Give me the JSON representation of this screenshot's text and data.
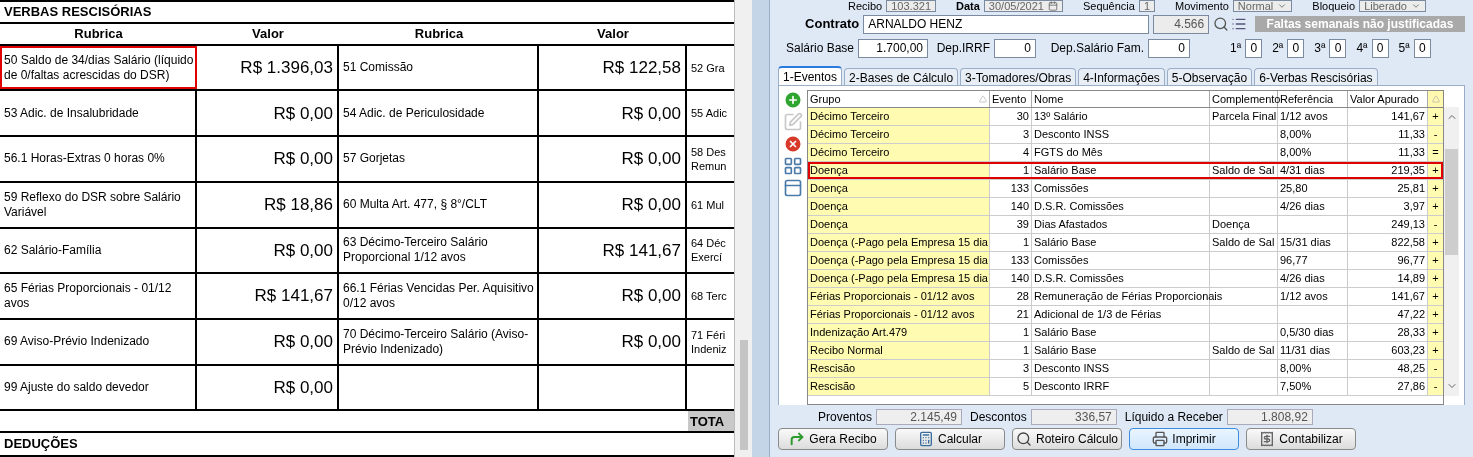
{
  "document": {
    "title": "VERBAS RESCISÓRIAS",
    "columns": [
      "Rubrica",
      "Valor",
      "Rubrica",
      "Valor"
    ],
    "rows": [
      {
        "cells": [
          {
            "text": "50 Saldo de 34/dias Salário (líquido de 0/faltas acrescidas do DSR)",
            "highlighted": true
          },
          {
            "text": "R$ 1.396,03"
          },
          {
            "text": "51 Comissão"
          },
          {
            "text": "R$ 122,58"
          },
          {
            "lines": [
              "52 Gra"
            ]
          }
        ]
      },
      {
        "cells": [
          {
            "text": "53 Adic. de Insalubridade"
          },
          {
            "text": "R$ 0,00"
          },
          {
            "text": "54 Adic. de Periculosidade"
          },
          {
            "text": "R$ 0,00"
          },
          {
            "lines": [
              "55 Adic"
            ]
          }
        ]
      },
      {
        "cells": [
          {
            "text": "56.1 Horas-Extras 0 horas 0%"
          },
          {
            "text": "R$ 0,00"
          },
          {
            "text": "57 Gorjetas"
          },
          {
            "text": "R$ 0,00"
          },
          {
            "lines": [
              "58 Des",
              "Remun"
            ]
          }
        ]
      },
      {
        "cells": [
          {
            "text": "59 Reflexo do DSR sobre Salário Variável"
          },
          {
            "text": "R$ 18,86"
          },
          {
            "text": "60 Multa Art. 477, § 8°/CLT"
          },
          {
            "text": "R$ 0,00"
          },
          {
            "lines": [
              "61 Mul"
            ]
          }
        ]
      },
      {
        "cells": [
          {
            "text": "62 Salário-Família"
          },
          {
            "text": "R$ 0,00"
          },
          {
            "text": "63 Décimo-Terceiro Salário Proporcional 1/12 avos"
          },
          {
            "text": "R$ 141,67"
          },
          {
            "lines": [
              "64 Déc",
              "Exercí"
            ]
          }
        ]
      },
      {
        "cells": [
          {
            "text": "65 Férias Proporcionais - 01/12 avos"
          },
          {
            "text": "R$ 141,67"
          },
          {
            "text": "66.1 Férias Vencidas Per. Aquisitivo 0/12 avos"
          },
          {
            "text": "R$ 0,00"
          },
          {
            "lines": [
              "68 Terc"
            ]
          }
        ]
      },
      {
        "cells": [
          {
            "text": "69 Aviso-Prévio Indenizado"
          },
          {
            "text": "R$ 0,00"
          },
          {
            "text": "70 Décimo-Terceiro Salário (Aviso-Prévio Indenizado)"
          },
          {
            "text": "R$ 0,00"
          },
          {
            "lines": [
              "71 Féri",
              "Indeniz"
            ]
          }
        ]
      },
      {
        "cells": [
          {
            "text": "99 Ajuste do saldo devedor"
          },
          {
            "text": "R$ 0,00"
          },
          {
            "text": ""
          },
          {
            "text": ""
          },
          {}
        ]
      }
    ],
    "total_label": "TOTA",
    "next_section": "DEDUÇÕES"
  },
  "app": {
    "top_fields": [
      {
        "label": "Recibo",
        "value": "103.321",
        "kind": "text"
      },
      {
        "label": "Data",
        "value": "30/05/2021",
        "kind": "date"
      },
      {
        "label": "Sequência",
        "value": "1",
        "kind": "text"
      },
      {
        "label": "Movimento",
        "value": "Normal",
        "kind": "select"
      },
      {
        "label": "Bloqueio",
        "value": "Liberado",
        "kind": "select"
      }
    ],
    "contrato": {
      "label": "Contrato",
      "name": "ARNALDO HENZ",
      "code": "4.566"
    },
    "faltas_title": "Faltas semanais não justificadas",
    "base_fields": [
      {
        "label": "Salário Base",
        "value": "1.700,00"
      },
      {
        "label": "Dep.IRRF",
        "value": "0"
      },
      {
        "label": "Dep.Salário Fam.",
        "value": "0"
      }
    ],
    "faltas": [
      {
        "label": "1ª",
        "value": "0"
      },
      {
        "label": "2ª",
        "value": "0"
      },
      {
        "label": "3ª",
        "value": "0"
      },
      {
        "label": "4ª",
        "value": "0"
      },
      {
        "label": "5ª",
        "value": "0"
      }
    ],
    "tabs": [
      {
        "label": "1-Eventos",
        "selected": true
      },
      {
        "label": "2-Bases de Cálculo",
        "selected": false
      },
      {
        "label": "3-Tomadores/Obras",
        "selected": false
      },
      {
        "label": "4-Informações",
        "selected": false
      },
      {
        "label": "5-Observação",
        "selected": false
      },
      {
        "label": "6-Verbas Rescisórias",
        "selected": false
      }
    ],
    "grid": {
      "columns": [
        "Grupo",
        "Evento",
        "Nome",
        "Complemento",
        "Referência",
        "Valor Apurado"
      ],
      "rows": [
        {
          "grupo": "Décimo Terceiro",
          "evento": "30",
          "nome": "13º Salário",
          "complemento": "Parcela Final",
          "referencia": "1/12 avos",
          "valor": "141,67",
          "sinal": "+",
          "highlighted": false
        },
        {
          "grupo": "Décimo Terceiro",
          "evento": "3",
          "nome": "Desconto INSS",
          "complemento": "",
          "referencia": "8,00%",
          "valor": "11,33",
          "sinal": "-",
          "highlighted": false
        },
        {
          "grupo": "Décimo Terceiro",
          "evento": "4",
          "nome": "FGTS do Mês",
          "complemento": "",
          "referencia": "8,00%",
          "valor": "11,33",
          "sinal": "=",
          "highlighted": false
        },
        {
          "grupo": "Doença",
          "evento": "1",
          "nome": "Salário Base",
          "complemento": "Saldo de Sal",
          "referencia": "4/31 dias",
          "valor": "219,35",
          "sinal": "+",
          "highlighted": true
        },
        {
          "grupo": "Doença",
          "evento": "133",
          "nome": "Comissões",
          "complemento": "",
          "referencia": "25,80",
          "valor": "25,81",
          "sinal": "+",
          "highlighted": false
        },
        {
          "grupo": "Doença",
          "evento": "140",
          "nome": "D.S.R. Comissões",
          "complemento": "",
          "referencia": "4/26 dias",
          "valor": "3,97",
          "sinal": "+",
          "highlighted": false
        },
        {
          "grupo": "Doença",
          "evento": "39",
          "nome": "Dias Afastados",
          "complemento": "Doença",
          "referencia": "",
          "valor": "249,13",
          "sinal": "-",
          "highlighted": false
        },
        {
          "grupo": "Doença (-Pago pela Empresa 15 dia",
          "evento": "1",
          "nome": "Salário Base",
          "complemento": "Saldo de Sal",
          "referencia": "15/31 dias",
          "valor": "822,58",
          "sinal": "+",
          "highlighted": false
        },
        {
          "grupo": "Doença (-Pago pela Empresa 15 dia",
          "evento": "133",
          "nome": "Comissões",
          "complemento": "",
          "referencia": "96,77",
          "valor": "96,77",
          "sinal": "+",
          "highlighted": false
        },
        {
          "grupo": "Doença (-Pago pela Empresa 15 dia",
          "evento": "140",
          "nome": "D.S.R. Comissões",
          "complemento": "",
          "referencia": "4/26 dias",
          "valor": "14,89",
          "sinal": "+",
          "highlighted": false
        },
        {
          "grupo": "Férias Proporcionais - 01/12 avos",
          "evento": "28",
          "nome": "Remuneração de Férias Proporcionais",
          "complemento": "",
          "referencia": "1/12 avos",
          "valor": "141,67",
          "sinal": "+",
          "highlighted": false
        },
        {
          "grupo": "Férias Proporcionais - 01/12 avos",
          "evento": "21",
          "nome": "Adicional de 1/3 de Férias",
          "complemento": "",
          "referencia": "",
          "valor": "47,22",
          "sinal": "+",
          "highlighted": false
        },
        {
          "grupo": "Indenização Art.479",
          "evento": "1",
          "nome": "Salário Base",
          "complemento": "",
          "referencia": "0,5/30 dias",
          "valor": "28,33",
          "sinal": "+",
          "highlighted": false
        },
        {
          "grupo": "Recibo Normal",
          "evento": "1",
          "nome": "Salário Base",
          "complemento": "Saldo de Sal",
          "referencia": "11/31 dias",
          "valor": "603,23",
          "sinal": "+",
          "highlighted": false
        },
        {
          "grupo": "Rescisão",
          "evento": "3",
          "nome": "Desconto INSS",
          "complemento": "",
          "referencia": "8,00%",
          "valor": "48,25",
          "sinal": "-",
          "highlighted": false
        },
        {
          "grupo": "Rescisão",
          "evento": "5",
          "nome": "Desconto IRRF",
          "complemento": "",
          "referencia": "7,50%",
          "valor": "27,86",
          "sinal": "-",
          "highlighted": false
        }
      ]
    },
    "totals": [
      {
        "label": "Proventos",
        "value": "2.145,49"
      },
      {
        "label": "Descontos",
        "value": "336,57"
      },
      {
        "label": "Líquido a Receber",
        "value": "1.808,92"
      }
    ],
    "buttons": [
      {
        "label": "Gera Recibo",
        "kind": "recibo",
        "default": false
      },
      {
        "label": "Calcular",
        "kind": "calc",
        "default": false
      },
      {
        "label": "Roteiro Cálculo",
        "kind": "roteiro",
        "default": false
      },
      {
        "label": "Imprimir",
        "kind": "print",
        "default": true
      },
      {
        "label": "Contabilizar",
        "kind": "contab",
        "default": false
      }
    ]
  }
}
